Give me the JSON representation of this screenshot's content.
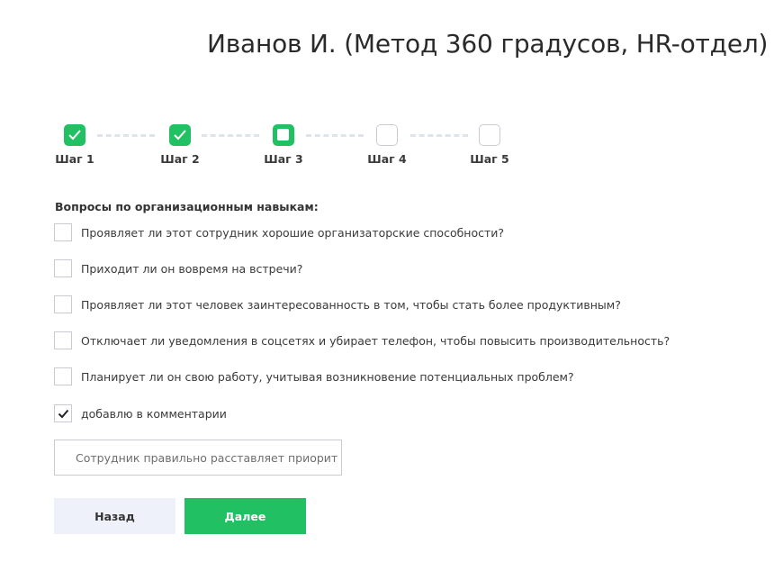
{
  "page": {
    "title": "Иванов И. (Метод 360 градусов, HR-отдел)"
  },
  "stepper": {
    "steps": [
      {
        "label": "Шаг 1",
        "state": "done"
      },
      {
        "label": "Шаг 2",
        "state": "done"
      },
      {
        "label": "Шаг 3",
        "state": "current"
      },
      {
        "label": "Шаг 4",
        "state": "pending"
      },
      {
        "label": "Шаг 5",
        "state": "pending"
      }
    ]
  },
  "questions": {
    "section_title": "Вопросы по организационным навыкам:",
    "items": [
      {
        "text": "Проявляет ли этот сотрудник хорошие организаторские способности?",
        "checked": false
      },
      {
        "text": "Приходит ли он вовремя на встречи?",
        "checked": false
      },
      {
        "text": "Проявляет ли этот человек заинтересованность в том, чтобы стать более продуктивным?",
        "checked": false
      },
      {
        "text": "Отключает ли уведомления в соцсетях и убирает телефон, чтобы повысить производительность?",
        "checked": false
      },
      {
        "text": "Планирует ли он свою работу, учитывая возникновение потенциальных проблем?",
        "checked": false
      },
      {
        "text": "добавлю в комментарии",
        "checked": true
      }
    ]
  },
  "comment": {
    "value": "Сотрудник правильно расставляет приорит"
  },
  "actions": {
    "back_label": "Назад",
    "next_label": "Далее"
  },
  "colors": {
    "accent": "#21c063",
    "secondary_button": "#eef1f9",
    "border": "#c8ccd2"
  }
}
